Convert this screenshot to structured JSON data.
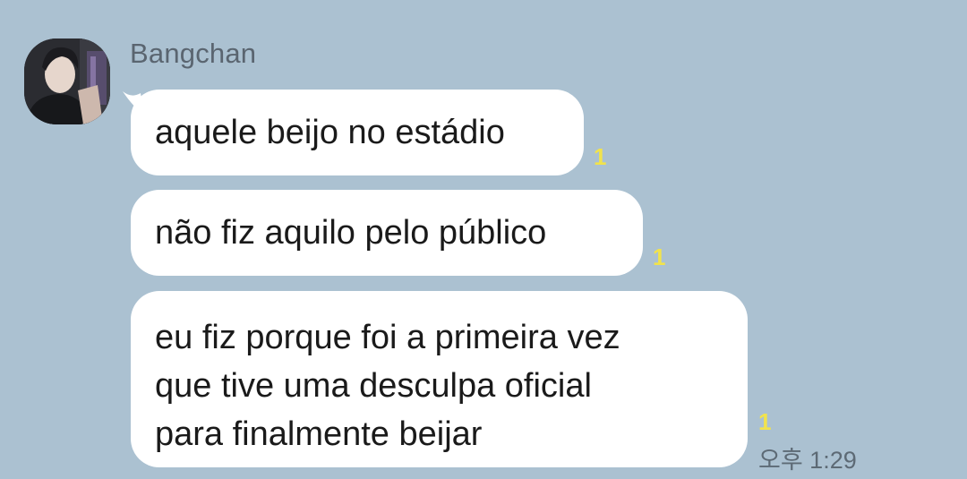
{
  "chat": {
    "sender": {
      "name": "Bangchan",
      "avatar_icon": "profile-photo"
    },
    "messages": [
      {
        "text": "aquele beijo no estádio",
        "unread_count": "1"
      },
      {
        "text": " não fiz aquilo pelo público",
        "unread_count": "1"
      },
      {
        "text": "eu fiz porque foi a primeira vez\nque tive uma desculpa oficial\npara finalmente beijar",
        "unread_count": "1"
      }
    ],
    "timestamp": "오후 1:29"
  },
  "colors": {
    "background": "#abc1d1",
    "bubble": "#ffffff",
    "unread": "#f1e34c",
    "meta_text": "#5d6a75"
  }
}
